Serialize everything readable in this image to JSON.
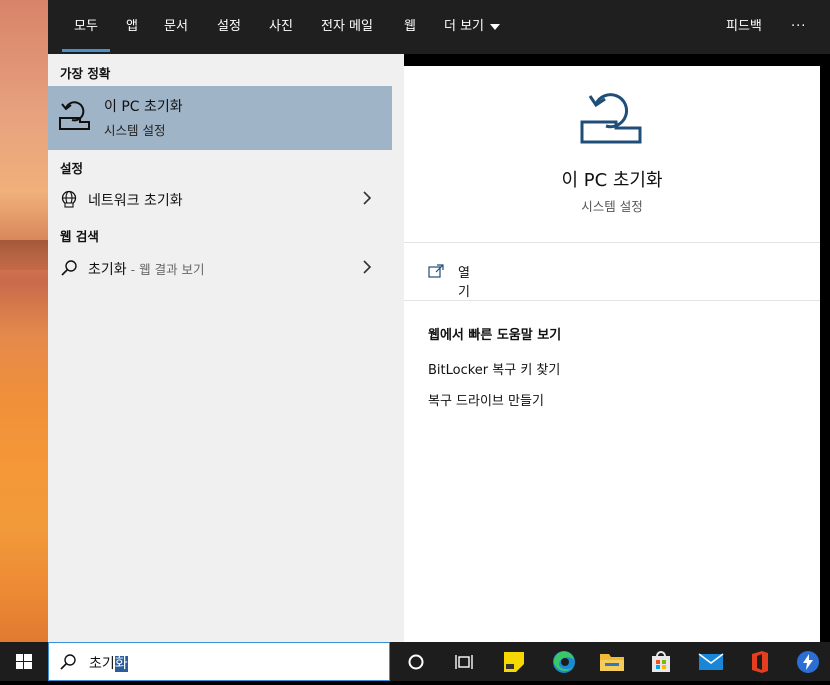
{
  "topnav": {
    "tabs": [
      "모두",
      "앱",
      "문서",
      "설정",
      "사진",
      "전자 메일",
      "웹"
    ],
    "more": "더 보기",
    "feedback": "피드백",
    "options": "···"
  },
  "results": {
    "best_match_label": "가장 정확",
    "best_match": {
      "title": "이 PC 초기화",
      "subtitle": "시스템 설정"
    },
    "settings_label": "설정",
    "settings_item": "네트워크 초기화",
    "web_label": "웹 검색",
    "web_item": {
      "term": "초기화",
      "suffix": " - 웹 결과 보기"
    }
  },
  "detail": {
    "title": "이 PC 초기화",
    "subtitle": "시스템 설정",
    "open_label": "열기",
    "help_title": "웹에서 빠른 도움말 보기",
    "help_links": [
      "BitLocker 복구 키 찾기",
      "복구 드라이브 만들기"
    ]
  },
  "search": {
    "typed": "초기",
    "selected": "화"
  },
  "taskbar": {
    "icons": [
      "windows-start-icon",
      "cortana-icon",
      "task-view-icon",
      "sticky-notes-icon",
      "edge-icon",
      "file-explorer-icon",
      "store-icon",
      "mail-icon",
      "office-icon",
      "app-icon"
    ]
  },
  "colors": {
    "accent": "#4a90c8",
    "selected_row": "#9fb4c7",
    "icon_blue": "#1f4e79"
  }
}
